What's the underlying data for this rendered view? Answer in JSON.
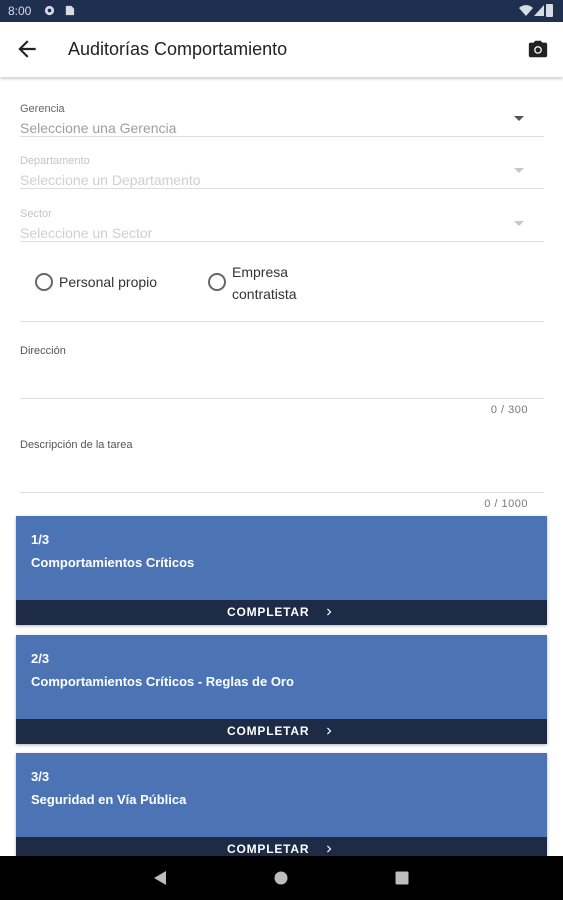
{
  "status_bar": {
    "time": "8:00"
  },
  "app_bar": {
    "title": "Auditorías Comportamiento"
  },
  "form": {
    "gerencia": {
      "label": "Gerencia",
      "placeholder": "Seleccione una Gerencia"
    },
    "departamento": {
      "label": "Departamento",
      "placeholder": "Seleccione un Departamento"
    },
    "sector": {
      "label": "Sector",
      "placeholder": "Seleccione un Sector"
    },
    "radio_options": [
      "Personal propio",
      "Empresa contratista"
    ],
    "direccion": {
      "label": "Dirección",
      "value": "",
      "counter": "0 / 300"
    },
    "descripcion": {
      "label": "Descripción de la tarea",
      "value": "",
      "counter": "0 / 1000"
    }
  },
  "cards": [
    {
      "step": "1/3",
      "title": "Comportamientos Críticos",
      "button": "COMPLETAR"
    },
    {
      "step": "2/3",
      "title": "Comportamientos Críticos - Reglas de Oro",
      "button": "COMPLETAR"
    },
    {
      "step": "3/3",
      "title": "Seguridad en Vía Pública",
      "button": "COMPLETAR"
    }
  ],
  "colors": {
    "status_bar": "#1f2f4f",
    "card": "#4c74b5",
    "card_button": "#1d2b47"
  },
  "icons": {
    "back": "arrow-left",
    "camera": "camera",
    "card_button": "chevron-right"
  }
}
